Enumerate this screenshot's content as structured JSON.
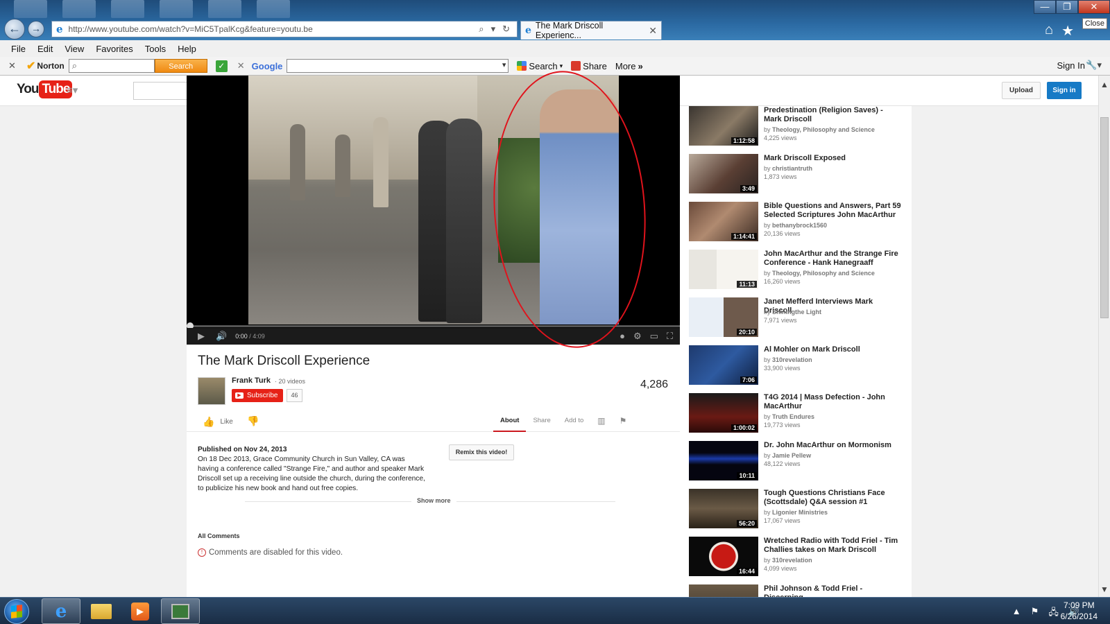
{
  "browser": {
    "url": "http://www.youtube.com/watch?v=MiC5TpalKcg&feature=youtu.be",
    "tab_title": "The Mark Driscoll Experienc...",
    "close_tooltip": "Close",
    "menu": [
      "File",
      "Edit",
      "View",
      "Favorites",
      "Tools",
      "Help"
    ]
  },
  "toolbar": {
    "norton_label": "Norton",
    "norton_search_button": "Search",
    "google_label": "Google",
    "search_label": "Search",
    "share_label": "Share",
    "more_label": "More",
    "signin_label": "Sign In"
  },
  "youtube": {
    "logo_you": "You",
    "logo_tube": "Tube",
    "upload_label": "Upload",
    "signin_label": "Sign in"
  },
  "player": {
    "current_time": "0:00",
    "duration": "/ 4:09"
  },
  "video": {
    "title": "The Mark Driscoll Experience",
    "uploader": "Frank Turk",
    "uploader_videos": "· 20 videos",
    "subscribe_label": "Subscribe",
    "subscriber_count": "46",
    "view_count": "4,286",
    "like_label": "Like",
    "tabs": [
      "About",
      "Share",
      "Add to"
    ],
    "published": "Published on Nov 24, 2013",
    "description": "On 18 Dec 2013, Grace Community Church in Sun Valley, CA was having a conference called \"Strange Fire,\" and author and speaker Mark Driscoll set up a receiving line outside the church, during the conference, to publicize his new book and hand out free copies.",
    "remix_label": "Remix this video!",
    "show_more_label": "Show more",
    "all_comments_label": "All Comments",
    "comments_disabled": "Comments are disabled for this video."
  },
  "related": [
    {
      "title": "Predestination (Religion Saves) - Mark Driscoll",
      "by": "by",
      "channel": "Theology, Philosophy and Science",
      "views": "4,225 views",
      "duration": "1:12:58"
    },
    {
      "title": "Mark Driscoll Exposed",
      "by": "by",
      "channel": "christiantruth",
      "views": "1,873 views",
      "duration": "3:49"
    },
    {
      "title": "Bible Questions and Answers, Part 59 Selected Scriptures John MacArthur",
      "by": "by",
      "channel": "bethanybrock1560",
      "views": "20,136 views",
      "duration": "1:14:41"
    },
    {
      "title": "John MacArthur and the Strange Fire Conference - Hank Hanegraaff",
      "by": "by",
      "channel": "Theology, Philosophy and Science",
      "views": "16,260 views",
      "duration": "11:13"
    },
    {
      "title": "Janet Mefferd Interviews Mark Driscoll",
      "by": "by",
      "channel": "Shiningthe Light",
      "views": "7,971 views",
      "duration": "20:10"
    },
    {
      "title": "Al Mohler on Mark Driscoll",
      "by": "by",
      "channel": "310revelation",
      "views": "33,900 views",
      "duration": "7:06"
    },
    {
      "title": "T4G 2014 | Mass Defection - John MacArthur",
      "by": "by",
      "channel": "Truth Endures",
      "views": "19,773 views",
      "duration": "1:00:02"
    },
    {
      "title": "Dr. John MacArthur on Mormonism",
      "by": "by",
      "channel": "Jamie Pellew",
      "views": "48,122 views",
      "duration": "10:11"
    },
    {
      "title": "Tough Questions Christians Face (Scottsdale) Q&A session #1",
      "by": "by",
      "channel": "Ligonier Ministries",
      "views": "17,067 views",
      "duration": "56:20"
    },
    {
      "title": "Wretched Radio with Todd Friel - Tim Challies takes on Mark Driscoll",
      "by": "by",
      "channel": "310revelation",
      "views": "4,099 views",
      "duration": "16:44"
    },
    {
      "title": "Phil Johnson & Todd Friel - Discerning",
      "by": "",
      "channel": "",
      "views": "",
      "duration": ""
    }
  ],
  "taskbar": {
    "time": "7:09 PM",
    "date": "6/26/2014"
  },
  "colors": {
    "youtube_red": "#e62117",
    "signin_blue": "#167ac6",
    "annotation_red": "#e0131c",
    "taskbar": "#1a2d45"
  }
}
